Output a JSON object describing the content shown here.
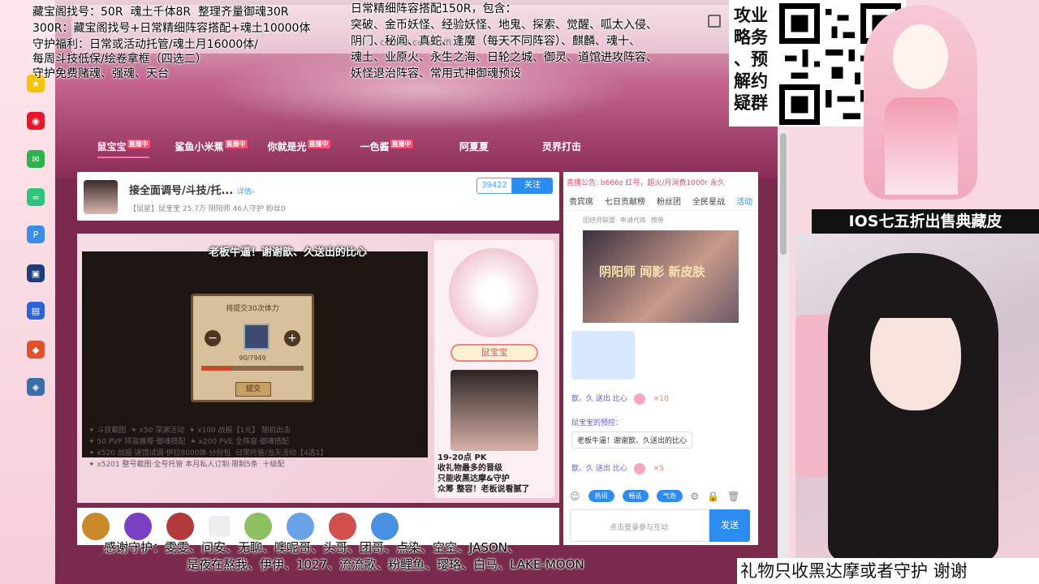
{
  "overlay": {
    "top_left_lines": [
      "藏宝阁找号：50R  魂土千体8R  整理齐量御魂30R",
      "300R：藏宝阁找号+日常精细阵容搭配+魂土10000体",
      "守护福利：日常或活动托管/魂土月16000体/",
      "每周斗技低保/绘卷拿框（四选二）",
      "守护免费赌魂、强魂、天台"
    ],
    "top_right_lines": [
      "日常精细阵容搭配150R，包含：",
      "突破、金币妖怪、经验妖怪、地鬼、探索、觉醒、呱太入侵、",
      "阴门、秘闻、真蛇、逢魔（每天不同阵容）、麒麟、魂十、",
      "魂土、业原火、永生之海、日轮之城、御灵、道馆进攻阵容、",
      "妖怪退治阵容、常用式神御魂预设"
    ],
    "qr_caption": "攻业\n略务\n、预\n解约\n疑群",
    "skin_banner": "IOS七五折出售典藏皮",
    "thanks_line1": "感谢守护：雯雯、问安、无聊、噢呢哥、头哥、团哥、点染、空空、JASON、",
    "thanks_line2": "是夜在熬我、伊伊、1027、流流歌、粉鲤鱼、璎珞、白马、LAKE-MOON",
    "footer_note": "礼物只收黑达摩或者守护 谢谢"
  },
  "browser": {
    "url_fragment": "cc.163.com/zt/fi",
    "streamer_tabs": [
      {
        "label": "鼠宝宝",
        "live": "直播中",
        "active": true
      },
      {
        "label": "鲨鱼小米蕉",
        "live": "直播中",
        "active": false
      },
      {
        "label": "你就是光",
        "live": "直播中",
        "active": false
      },
      {
        "label": "一色酱",
        "live": "直播中",
        "active": false
      },
      {
        "label": "阿夏夏",
        "live": "",
        "active": false
      },
      {
        "label": "灵界打击",
        "live": "",
        "active": false
      }
    ]
  },
  "room": {
    "title": "接全面调号/斗技/托...",
    "tag": "详情›",
    "meta": "【鼠星】鼠宝宝  25.7万  阴阳师  46人守护  粉丝0",
    "followers": "39422",
    "follow_label": "关注"
  },
  "player": {
    "gift_toast": "老板牛逼！谢谢歆、久送出的比心",
    "dialog_title": "将提交30次体力",
    "dialog_count": "90/7949",
    "dialog_confirm": "提交",
    "name_sign": "鼠宝宝",
    "pk_note": "19-20点 PK\n收礼物最多的晋级\n只能收黑达摩&守护\n众筹 整容！老板说看腻了",
    "rules": "✦ 斗技截图  ✦ x50 深渊活动  ✦ x100 战报【1元】 随机出击\n✦ 50 PVP 阵容推荐·御魂搭配  ✦ x200 PVE 全阵容·御魂搭配\n✦ x520 战报·道馆试调·伊拉8000体·分份包  日常托管/当天活动【4选1】\n✦ x5201 整号截图·全号托管 本月私人订制·限制5条  十级配",
    "gift_bar_progress": 0.3
  },
  "chat": {
    "announcement": "直播公告: b666z 红号，超火/月消费1000r 永久",
    "tabs": [
      "贵宾席",
      "七日贡献榜",
      "粉丝团",
      "全民星战",
      "活动"
    ],
    "active_tab": "活动",
    "subtabs": [
      "团结师联盟",
      "申请代练",
      "榜单"
    ],
    "poster_text": "阴阳师 闻影 新皮肤",
    "messages": [
      {
        "user": "歆、久 送出 比心",
        "count": "×10"
      },
      {
        "user": "鼠宝宝的预控：",
        "count": ""
      },
      {
        "user": "歆、久 送出 比心",
        "count": "×5"
      }
    ],
    "bubble": "老板牛逼！谢谢歆、久送出的比心",
    "chips": [
      "热词",
      "畅话",
      "气泡"
    ],
    "input_placeholder": "点击登录参与互动",
    "send_label": "发送"
  }
}
